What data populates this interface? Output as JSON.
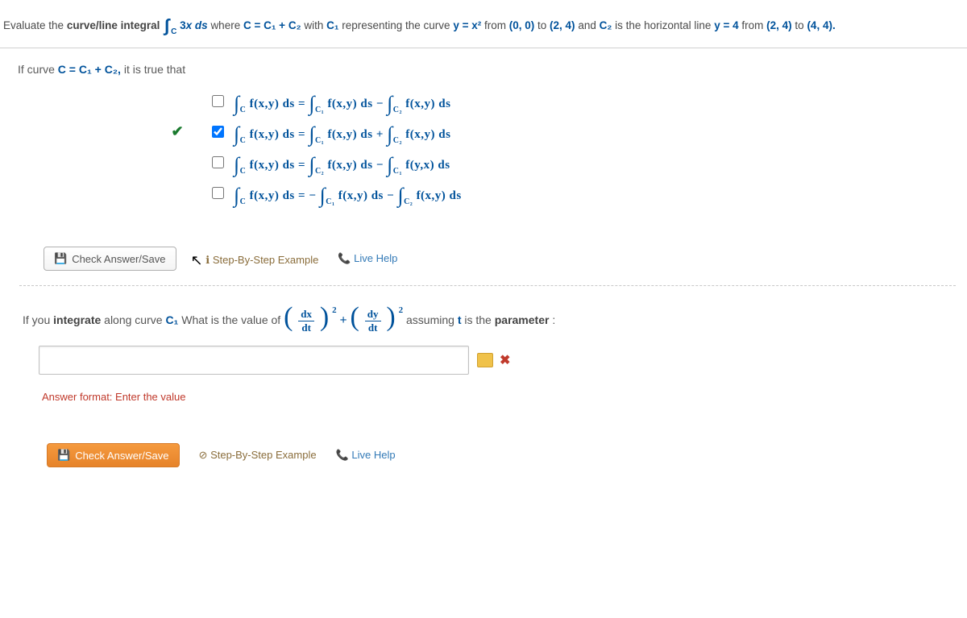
{
  "problem": {
    "lead_in": "Evaluate the ",
    "term_curve_line": "curve/line integral",
    "integral_expr": "∫C 3x ds",
    "where": " where ",
    "c_expr": "C = C₁ + C₂",
    "with_text": " with ",
    "c1_label": "C₁",
    "repr_text": " representing the curve ",
    "curve_eq": "y = x²",
    "from1": " from ",
    "p00": "(0, 0)",
    "to1": " to ",
    "p24": "(2, 4)",
    "and_text": " and ",
    "c2_label": "C₂",
    "horiz_text": " is the horizontal line ",
    "y4_eq": "y = 4",
    "from2": " from ",
    "p24b": "(2, 4)",
    "to2": " to ",
    "p44": "(4, 4).",
    "cond_text": "If curve ",
    "cond_eq": "C = C₁ + C₂,",
    "cond_tail": " it is true that"
  },
  "options": [
    {
      "checked_correct": false,
      "box_checked": false,
      "math": "∫C f(x,y) ds = ∫C₁ f(x,y) ds − ∫C₂ f(x,y) ds"
    },
    {
      "checked_correct": true,
      "box_checked": true,
      "math": "∫C f(x,y) ds = ∫C₁ f(x,y) ds + ∫C₂ f(x,y) ds"
    },
    {
      "checked_correct": false,
      "box_checked": false,
      "math": "∫C f(x,y) ds = ∫C₂ f(x,y) ds − ∫C₁ f(y,x) ds"
    },
    {
      "checked_correct": false,
      "box_checked": false,
      "math": "∫C f(x,y) ds = − ∫C₁ f(x,y) ds − ∫C₂ f(x,y) ds"
    }
  ],
  "buttons": {
    "check_save": "Check Answer/Save",
    "step_example": "Step-By-Step Example",
    "live_help": "Live Help"
  },
  "q2": {
    "lead": "If you ",
    "integrate_bold": "integrate",
    "mid": " along curve ",
    "c1_it": "C₁",
    "whatvalue": " What is the value of ",
    "dx": "dx",
    "dt": "dt",
    "plus": "+",
    "dy": "dy",
    "tail1": " assuming ",
    "tvar": "t",
    "tail2": " is the ",
    "param_bold": "parameter",
    "colon": " :"
  },
  "answer_input_value": "",
  "answer_format": "Answer format: Enter the value",
  "icons": {
    "disk": "disk-icon",
    "info": "info-icon",
    "phone": "phone-icon",
    "cursor": "cursor-icon",
    "stop": "stop-icon"
  }
}
